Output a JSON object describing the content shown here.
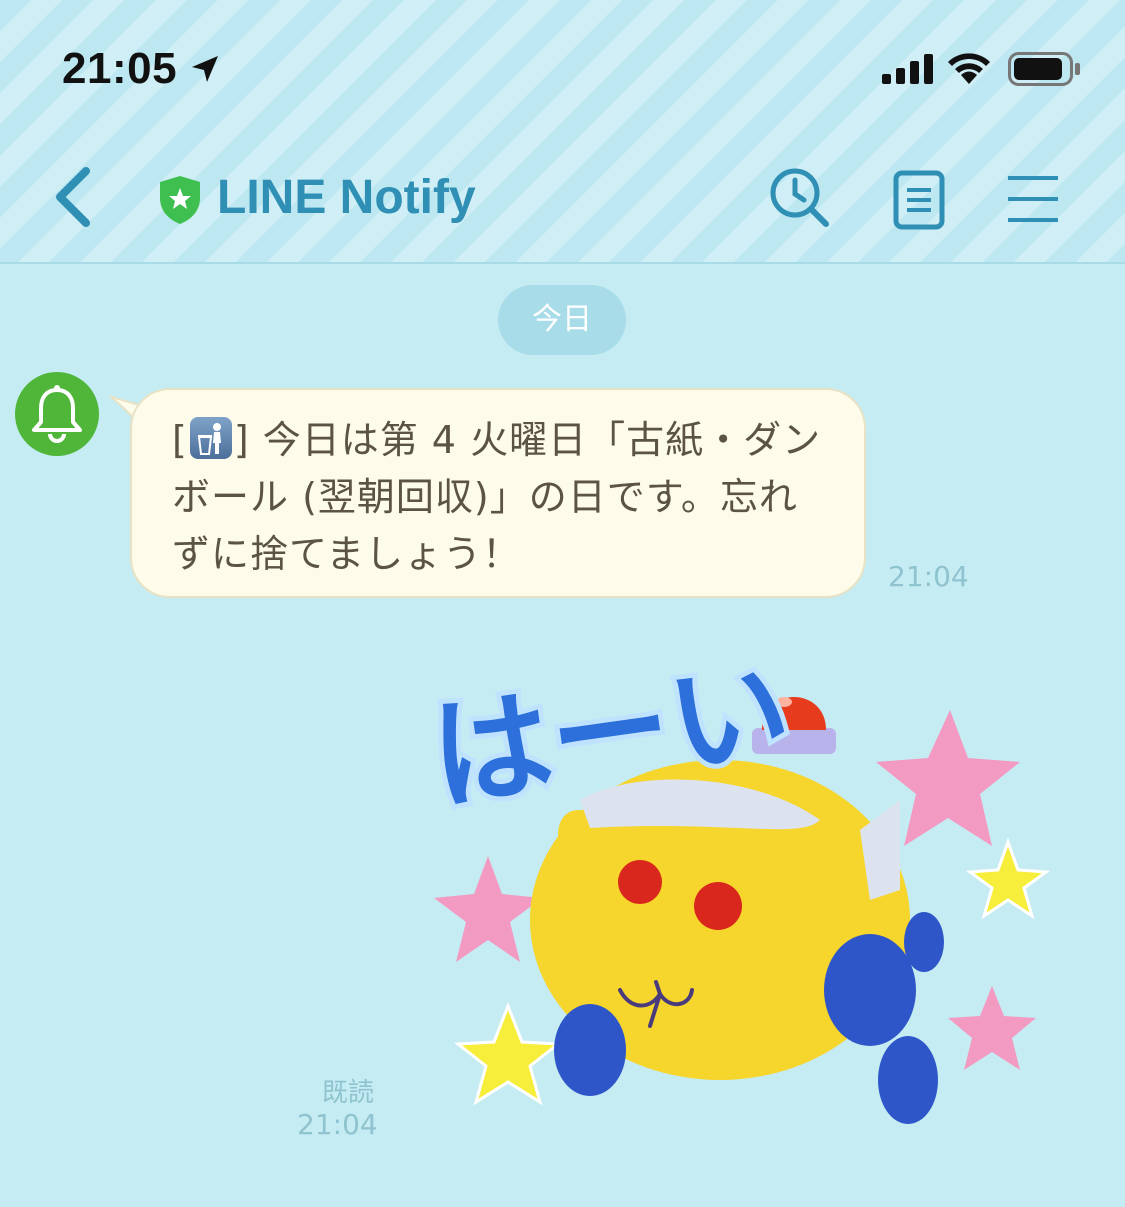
{
  "status_bar": {
    "time": "21:05",
    "icons": [
      "location-arrow-icon",
      "cellular-signal-icon",
      "wifi-icon",
      "battery-icon"
    ]
  },
  "header": {
    "back_icon": "chevron-left-icon",
    "badge_icon": "official-shield-star-icon",
    "title": "LINE Notify",
    "actions": [
      "search-icon",
      "notes-icon",
      "menu-icon"
    ],
    "accent_color": "#2f8fb4"
  },
  "chat": {
    "date_separator": "今日",
    "messages": [
      {
        "sender_avatar_icon": "bell-icon",
        "text_prefix": "[",
        "emoji_icon": "trash-can-emoji-icon",
        "text_body": "] 今日は第 4 火曜日「古紙・ダンボール (翌朝回収)」の日です。忘れずに捨てましょう！",
        "time": "21:04"
      }
    ],
    "reply": {
      "sticker_caption": "はーい",
      "read_label": "既読",
      "time": "21:04"
    }
  },
  "colors": {
    "background": "#c6ecf3",
    "bubble": "#fdfbe9",
    "avatar": "#4fb63a"
  }
}
